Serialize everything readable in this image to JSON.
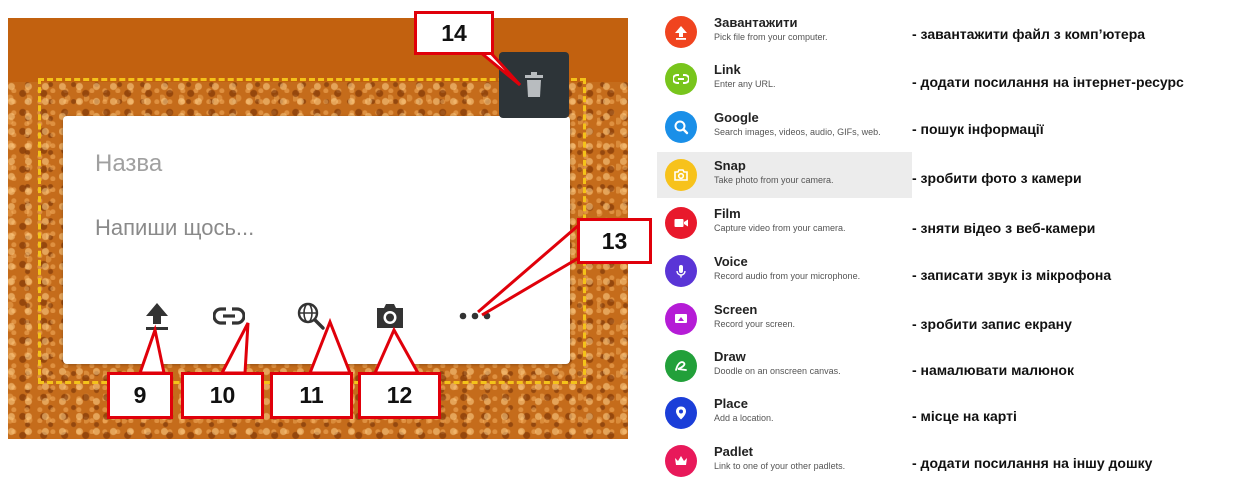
{
  "composer": {
    "title_placeholder": "Назва",
    "body_placeholder": "Напиши щось..."
  },
  "toolbar": [
    {
      "name": "upload",
      "icon": "upload-icon"
    },
    {
      "name": "link",
      "icon": "link-icon"
    },
    {
      "name": "search",
      "icon": "globe-search-icon"
    },
    {
      "name": "camera",
      "icon": "camera-icon"
    },
    {
      "name": "more",
      "icon": "more-horizontal-icon"
    }
  ],
  "trash_icon": "trash-icon",
  "callouts": {
    "upload": "9",
    "link": "10",
    "search": "11",
    "camera": "12",
    "more": "13",
    "trash": "14"
  },
  "colors": {
    "callout_border": "#e0000a",
    "dashed_frame": "#f4c21a"
  },
  "attachment_menu": [
    {
      "title": "Завантажити",
      "subtitle": "Pick file from your computer.",
      "description": "- завантажити файл з комп’ютера",
      "icon": "upload-icon",
      "color": "#f0441f"
    },
    {
      "title": "Link",
      "subtitle": "Enter any URL.",
      "description": "- додати посилання на інтернет-ресурс",
      "icon": "link-icon",
      "color": "#78c51c"
    },
    {
      "title": "Google",
      "subtitle": "Search images, videos, audio, GIFs, web.",
      "description": "- пошук інформації",
      "icon": "search-icon",
      "color": "#1a8fe8"
    },
    {
      "title": "Snap",
      "subtitle": "Take photo from your camera.",
      "description": "- зробити фото з камери",
      "icon": "camera-icon",
      "color": "#f7c21b"
    },
    {
      "title": "Film",
      "subtitle": "Capture video from your camera.",
      "description": "- зняти відео з веб-камери",
      "icon": "video-camera-icon",
      "color": "#e8192c"
    },
    {
      "title": "Voice",
      "subtitle": "Record audio from your microphone.",
      "description": "- записати звук із мікрофона",
      "icon": "microphone-icon",
      "color": "#5a35d6"
    },
    {
      "title": "Screen",
      "subtitle": "Record your screen.",
      "description": "- зробити запис екрану",
      "icon": "screen-record-icon",
      "color": "#b51cd6"
    },
    {
      "title": "Draw",
      "subtitle": "Doodle on an onscreen canvas.",
      "description": "- намалювати малюнок",
      "icon": "draw-icon",
      "color": "#22a03a"
    },
    {
      "title": "Place",
      "subtitle": "Add a location.",
      "description": "- місце на карті",
      "icon": "location-pin-icon",
      "color": "#1b3ed8"
    },
    {
      "title": "Padlet",
      "subtitle": "Link to one of your other padlets.",
      "description": "- додати посилання на іншу дошку",
      "icon": "crown-icon",
      "color": "#e8195a"
    }
  ],
  "highlighted_item": "Snap"
}
